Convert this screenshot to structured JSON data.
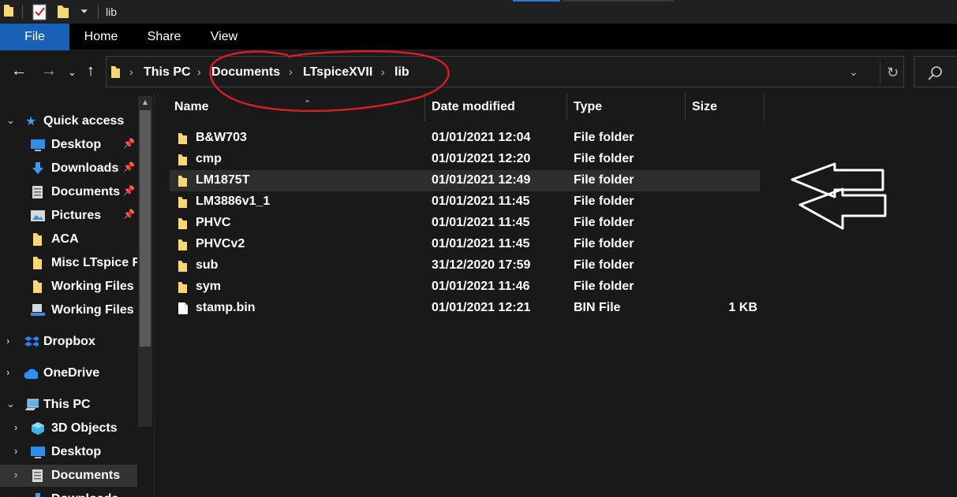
{
  "window": {
    "title": "lib"
  },
  "ribbon": {
    "tabs": [
      {
        "label": "File"
      },
      {
        "label": "Home"
      },
      {
        "label": "Share"
      },
      {
        "label": "View"
      }
    ],
    "accent": "#1a61b8"
  },
  "address": {
    "crumbs": [
      "This PC",
      "Documents",
      "LTspiceXVII",
      "lib"
    ]
  },
  "nav": {
    "quick_access": "Quick access",
    "items": [
      {
        "label": "Desktop",
        "icon": "desktop-icon",
        "pinned": true
      },
      {
        "label": "Downloads",
        "icon": "download-icon",
        "pinned": true
      },
      {
        "label": "Documents",
        "icon": "documents-icon",
        "pinned": true
      },
      {
        "label": "Pictures",
        "icon": "pictures-icon",
        "pinned": true
      },
      {
        "label": "ACA",
        "icon": "folder-icon",
        "pinned": false
      },
      {
        "label": "Misc LTspice F",
        "icon": "folder-icon",
        "pinned": false
      },
      {
        "label": "Working Files",
        "icon": "folder-icon",
        "pinned": false
      },
      {
        "label": "Working Files",
        "icon": "network-folder-icon",
        "pinned": false
      }
    ],
    "dropbox": "Dropbox",
    "onedrive": "OneDrive",
    "this_pc": "This PC",
    "pc_items": [
      {
        "label": "3D Objects",
        "icon": "3d-objects-icon"
      },
      {
        "label": "Desktop",
        "icon": "desktop-icon"
      },
      {
        "label": "Documents",
        "icon": "documents-icon"
      },
      {
        "label": "Downloads",
        "icon": "download-icon"
      }
    ]
  },
  "columns": {
    "name": "Name",
    "date": "Date modified",
    "type": "Type",
    "size": "Size"
  },
  "files": [
    {
      "name": "B&W703",
      "date": "01/01/2021 12:04",
      "type": "File folder",
      "size": "",
      "icon": "folder-icon"
    },
    {
      "name": "cmp",
      "date": "01/01/2021 12:20",
      "type": "File folder",
      "size": "",
      "icon": "folder-icon"
    },
    {
      "name": "LM1875T",
      "date": "01/01/2021 12:49",
      "type": "File folder",
      "size": "",
      "icon": "folder-icon"
    },
    {
      "name": "LM3886v1_1",
      "date": "01/01/2021 11:45",
      "type": "File folder",
      "size": "",
      "icon": "folder-icon"
    },
    {
      "name": "PHVC",
      "date": "01/01/2021 11:45",
      "type": "File folder",
      "size": "",
      "icon": "folder-icon"
    },
    {
      "name": "PHVCv2",
      "date": "01/01/2021 11:45",
      "type": "File folder",
      "size": "",
      "icon": "folder-icon"
    },
    {
      "name": "sub",
      "date": "31/12/2020 17:59",
      "type": "File folder",
      "size": "",
      "icon": "folder-icon"
    },
    {
      "name": "sym",
      "date": "01/01/2021 11:46",
      "type": "File folder",
      "size": "",
      "icon": "folder-icon"
    },
    {
      "name": "stamp.bin",
      "date": "01/01/2021 12:21",
      "type": "BIN File",
      "size": "1 KB",
      "icon": "file-icon"
    }
  ],
  "colors": {
    "folder": "#f8d775",
    "annotation": "#d11f24",
    "selection": "#2d2d2d"
  }
}
